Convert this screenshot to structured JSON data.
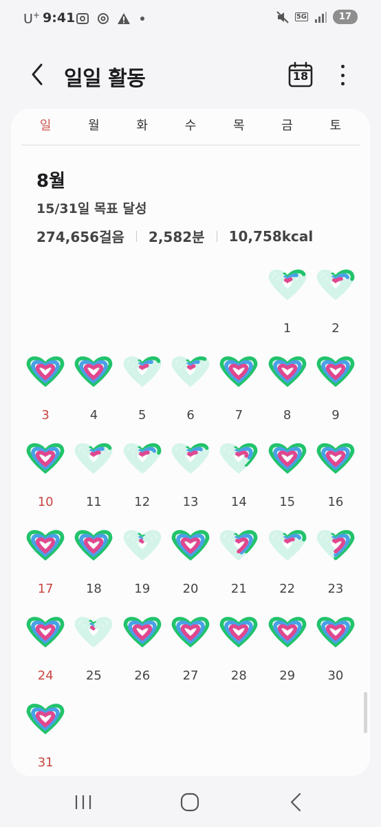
{
  "status": {
    "carrier": "U",
    "carrier_sup": "+",
    "time": "9:41",
    "network": "5G",
    "battery": "17"
  },
  "header": {
    "title": "일일 활동",
    "calendar_day": "18"
  },
  "weekdays": [
    "일",
    "월",
    "화",
    "수",
    "목",
    "금",
    "토"
  ],
  "summary": {
    "month": "8월",
    "goal": "15/31일 목표 달성",
    "steps": "274,656걸음",
    "minutes": "2,582분",
    "calories": "10,758kcal"
  },
  "colors": {
    "sunday": "#c9453f",
    "ring_steps": "#22c36b",
    "ring_active": "#4aa0e6",
    "ring_calories": "#e0478f",
    "faded": "#d4f4ea"
  },
  "calendar": {
    "first_weekday_index": 5,
    "days": [
      {
        "day": "1",
        "steps": 0.25,
        "active": 0.2,
        "calories": 0.15
      },
      {
        "day": "2",
        "steps": 0.3,
        "active": 0.25,
        "calories": 0.2
      },
      {
        "day": "3",
        "steps": 1,
        "active": 1,
        "calories": 1
      },
      {
        "day": "4",
        "steps": 1,
        "active": 1,
        "calories": 1
      },
      {
        "day": "5",
        "steps": 0.25,
        "active": 0.2,
        "calories": 0.18
      },
      {
        "day": "6",
        "steps": 0.22,
        "active": 0.18,
        "calories": 0.15
      },
      {
        "day": "7",
        "steps": 1,
        "active": 1,
        "calories": 1
      },
      {
        "day": "8",
        "steps": 1,
        "active": 1,
        "calories": 1
      },
      {
        "day": "9",
        "steps": 1,
        "active": 1,
        "calories": 1
      },
      {
        "day": "10",
        "steps": 1,
        "active": 1,
        "calories": 1
      },
      {
        "day": "11",
        "steps": 0.25,
        "active": 0.2,
        "calories": 0.2
      },
      {
        "day": "12",
        "steps": 0.3,
        "active": 0.25,
        "calories": 0.2
      },
      {
        "day": "13",
        "steps": 0.25,
        "active": 0.22,
        "calories": 0.2
      },
      {
        "day": "14",
        "steps": 0.45,
        "active": 0.35,
        "calories": 0.3
      },
      {
        "day": "15",
        "steps": 1,
        "active": 1,
        "calories": 1
      },
      {
        "day": "16",
        "steps": 1,
        "active": 1,
        "calories": 1
      },
      {
        "day": "17",
        "steps": 1,
        "active": 1,
        "calories": 1
      },
      {
        "day": "18",
        "steps": 1,
        "active": 1,
        "calories": 1
      },
      {
        "day": "19",
        "steps": 0.08,
        "active": 0.06,
        "calories": 0.05
      },
      {
        "day": "20",
        "steps": 1,
        "active": 1,
        "calories": 1
      },
      {
        "day": "21",
        "steps": 0.45,
        "active": 0.5,
        "calories": 0.7
      },
      {
        "day": "22",
        "steps": 0.3,
        "active": 0.25,
        "calories": 0.2
      },
      {
        "day": "23",
        "steps": 0.7,
        "active": 0.6,
        "calories": 0.6
      },
      {
        "day": "24",
        "steps": 1,
        "active": 1,
        "calories": 1
      },
      {
        "day": "25",
        "steps": 0.08,
        "active": 0.06,
        "calories": 0.05
      },
      {
        "day": "26",
        "steps": 1,
        "active": 1,
        "calories": 1
      },
      {
        "day": "27",
        "steps": 1,
        "active": 1,
        "calories": 1
      },
      {
        "day": "28",
        "steps": 1,
        "active": 1,
        "calories": 1
      },
      {
        "day": "29",
        "steps": 1,
        "active": 1,
        "calories": 1
      },
      {
        "day": "30",
        "steps": 1,
        "active": 1,
        "calories": 1
      },
      {
        "day": "31",
        "steps": 1,
        "active": 1,
        "calories": 1
      }
    ]
  }
}
